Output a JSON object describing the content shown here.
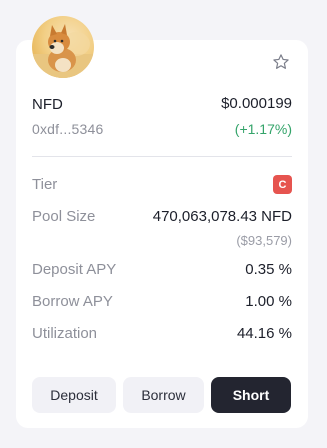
{
  "token": {
    "name": "NFD",
    "address": "0xdf...5346",
    "price": "$0.000199",
    "change": "(+1.17%)"
  },
  "colors": {
    "positive": "#34a46a",
    "tier_badge": "#e6544f",
    "primary_button": "#232530"
  },
  "icons": {
    "favorite": "star-outline-icon",
    "avatar": "shiba-dog-avatar"
  },
  "rows": {
    "tier": {
      "label": "Tier",
      "value": "C"
    },
    "pool_size": {
      "label": "Pool Size",
      "value": "470,063,078.43 NFD",
      "usd": "($93,579)"
    },
    "deposit_apy": {
      "label": "Deposit APY",
      "value": "0.35 %"
    },
    "borrow_apy": {
      "label": "Borrow APY",
      "value": "1.00 %"
    },
    "utilization": {
      "label": "Utilization",
      "value": "44.16 %"
    }
  },
  "buttons": {
    "deposit": "Deposit",
    "borrow": "Borrow",
    "short": "Short"
  }
}
